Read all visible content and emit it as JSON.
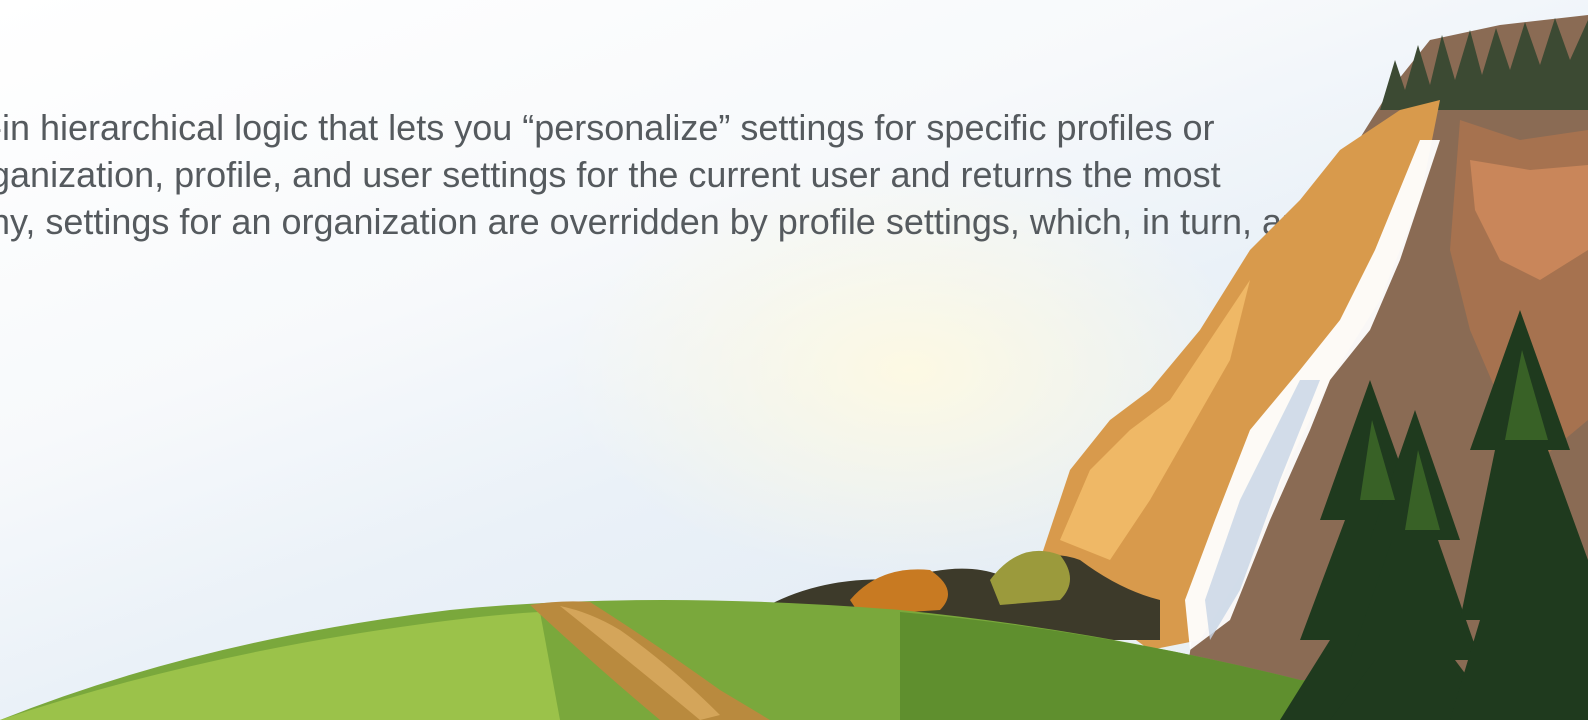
{
  "slide": {
    "text_lines": [
      "-in hierarchical logic that lets you “personalize” settings for specific profiles or",
      "ganization, profile, and user settings for the current user and returns the most",
      "hy, settings for an organization are overridden by profile settings, which, in turn, are"
    ]
  },
  "scene": {
    "illustration": "landscape-waterfall-cliff-forest",
    "colors": {
      "grass": "#7aa83c",
      "path": "#b98a3e",
      "cliff": "#d89a4c",
      "cliff_shadow": "#8a6b54",
      "waterfall": "#ffffff",
      "pine": "#1f3a1e",
      "text": "#555a5e"
    }
  }
}
